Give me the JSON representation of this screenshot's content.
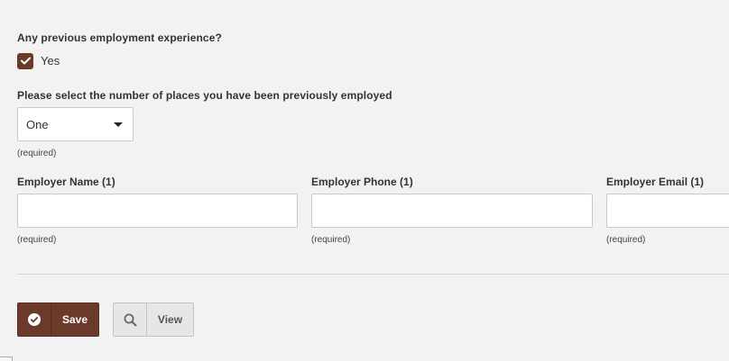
{
  "employment_question": {
    "label": "Any previous employment experience?",
    "checkbox_label": "Yes",
    "checked": true
  },
  "places_question": {
    "label": "Please select the number of places you have been previously employed",
    "selected_value": "One",
    "required_text": "(required)"
  },
  "employer_fields": [
    {
      "label": "Employer Name (1)",
      "value": "",
      "required_text": "(required)"
    },
    {
      "label": "Employer Phone (1)",
      "value": "",
      "required_text": "(required)"
    },
    {
      "label": "Employer Email (1)",
      "value": "",
      "required_text": "(required)"
    }
  ],
  "actions": {
    "save_label": "Save",
    "view_label": "View"
  },
  "icons": {
    "checkbox": "check-icon",
    "save": "check-circle-icon",
    "view": "search-icon",
    "select": "caret-down-icon"
  },
  "colors": {
    "accent": "#6b3a2a",
    "background": "#f2f2f2"
  }
}
